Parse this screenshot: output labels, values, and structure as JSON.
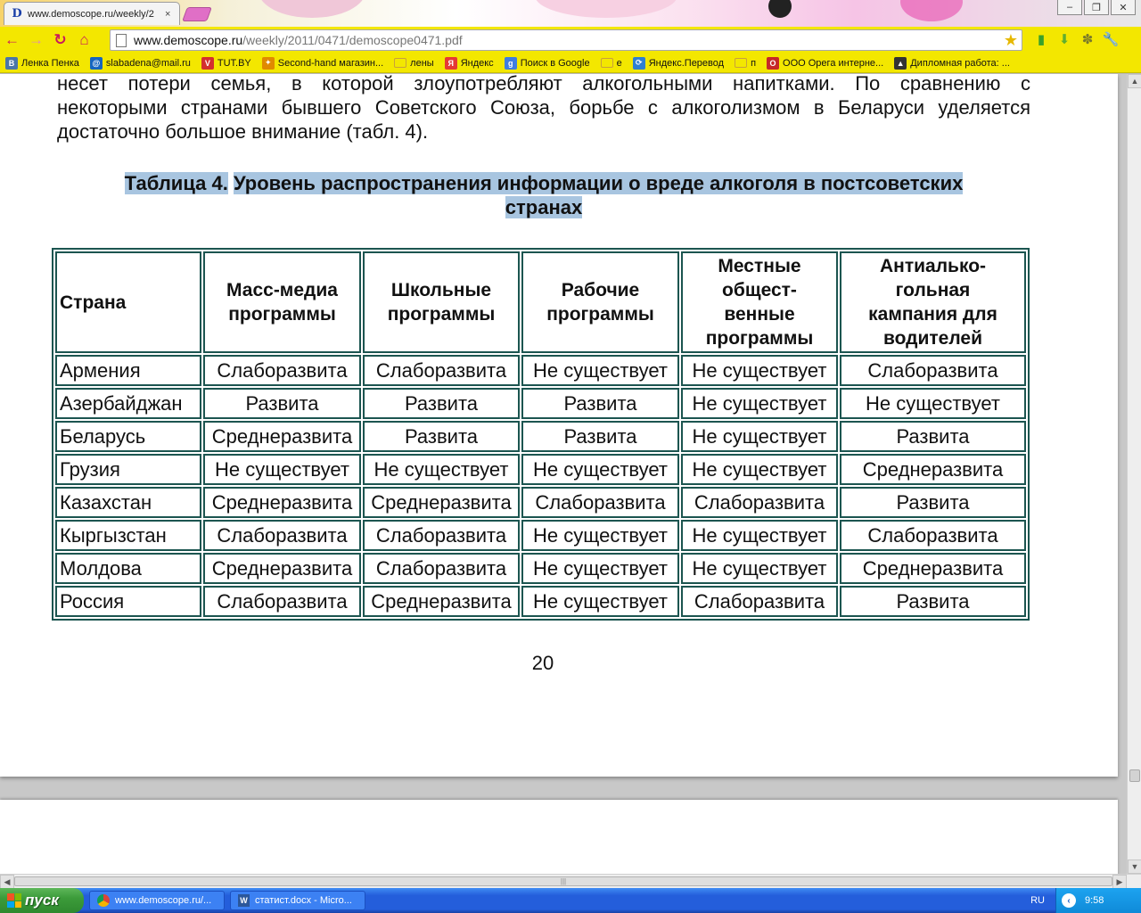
{
  "browser": {
    "tab_title": "www.demoscope.ru/weekly/2",
    "tab_favicon": "D",
    "tab_close": "×",
    "url_host": "www.demoscope.ru",
    "url_path": "/weekly/2011/0471/demoscope0471.pdf",
    "bookmarks": [
      {
        "icon": "vk-icon",
        "label": "Ленка Пенка",
        "color": "#4a76a8",
        "glyph": "B"
      },
      {
        "icon": "mail-icon",
        "label": "slabadena@mail.ru",
        "color": "#1565c0",
        "glyph": "@"
      },
      {
        "icon": "tutby-icon",
        "label": "TUT.BY",
        "color": "#d32f2f",
        "glyph": "V"
      },
      {
        "icon": "shop-icon",
        "label": "Second-hand магазин...",
        "color": "#e08a00",
        "glyph": "✦"
      },
      {
        "icon": "folder-icon",
        "label": "лены",
        "color": "#c9a13a",
        "glyph": ""
      },
      {
        "icon": "yandex-icon",
        "label": "Яндекс",
        "color": "#e53935",
        "glyph": "Я"
      },
      {
        "icon": "google-icon",
        "label": "Поиск в Google",
        "color": "#3f7de0",
        "glyph": "g"
      },
      {
        "icon": "folder-icon",
        "label": "е",
        "color": "#c9a13a",
        "glyph": ""
      },
      {
        "icon": "translate-icon",
        "label": "Яндекс.Перевод",
        "color": "#2f7fd0",
        "glyph": "⟳"
      },
      {
        "icon": "folder-icon",
        "label": "п",
        "color": "#c9a13a",
        "glyph": ""
      },
      {
        "icon": "opera-icon",
        "label": "ООО Орега интерне...",
        "color": "#c62828",
        "glyph": "O"
      },
      {
        "icon": "graduation-icon",
        "label": "Дипломная работа: ...",
        "color": "#333333",
        "glyph": "▲"
      }
    ]
  },
  "document": {
    "paragraph_lines": [
      "несет потери семья, в которой злоупотребляют алкогольными напитками. По сравнению с",
      "некоторыми странами бывшего Советского Союза, борьбе с алкоголизмом в Беларуси уделяется",
      "достаточно большое внимание (табл. 4)."
    ],
    "caption_part1": "Таблица 4.",
    "caption_part2": "Уровень распространения информации о вреде алкоголя в постсоветских",
    "caption_part3": "странах",
    "table": {
      "headers": [
        [
          "Страна"
        ],
        [
          "Масс-медиа",
          "программы"
        ],
        [
          "Школьные",
          "программы"
        ],
        [
          "Рабочие",
          "программы"
        ],
        [
          "Местные",
          "общест-",
          "венные",
          "программы"
        ],
        [
          "Антиалько-",
          "гольная",
          "кампания для",
          "водителей"
        ]
      ],
      "rows": [
        [
          "Армения",
          "Слаборазвита",
          "Слаборазвита",
          "Не существует",
          "Не существует",
          "Слаборазвита"
        ],
        [
          "Азербайджан",
          "Развита",
          "Развита",
          "Развита",
          "Не существует",
          "Не существует"
        ],
        [
          "Беларусь",
          "Среднеразвита",
          "Развита",
          "Развита",
          "Не существует",
          "Развита"
        ],
        [
          "Грузия",
          "Не существует",
          "Не существует",
          "Не существует",
          "Не существует",
          "Среднеразвита"
        ],
        [
          "Казахстан",
          "Среднеразвита",
          "Среднеразвита",
          "Слаборазвита",
          "Слаборазвита",
          "Развита"
        ],
        [
          "Кыргызстан",
          "Слаборазвита",
          "Слаборазвита",
          "Не существует",
          "Не существует",
          "Слаборазвита"
        ],
        [
          "Молдова",
          "Среднеразвита",
          "Слаборазвита",
          "Не существует",
          "Не существует",
          "Среднеразвита"
        ],
        [
          "Россия",
          "Слаборазвита",
          "Среднеразвита",
          "Не существует",
          "Слаборазвита",
          "Развита"
        ]
      ]
    },
    "page_number": "20"
  },
  "taskbar": {
    "start_label": "пуск",
    "items": [
      {
        "label": "www.demoscope.ru/...",
        "icon": "chrome-icon",
        "active": false
      },
      {
        "label": "статист.docx - Micro...",
        "icon": "word-icon",
        "active": false
      }
    ],
    "language": "RU",
    "clock": "9:58"
  },
  "colors": {
    "toolbar": "#f3e700",
    "table_border": "#1c5550",
    "caption_highlight": "#a8c5e0",
    "taskbar": "#245edb"
  }
}
